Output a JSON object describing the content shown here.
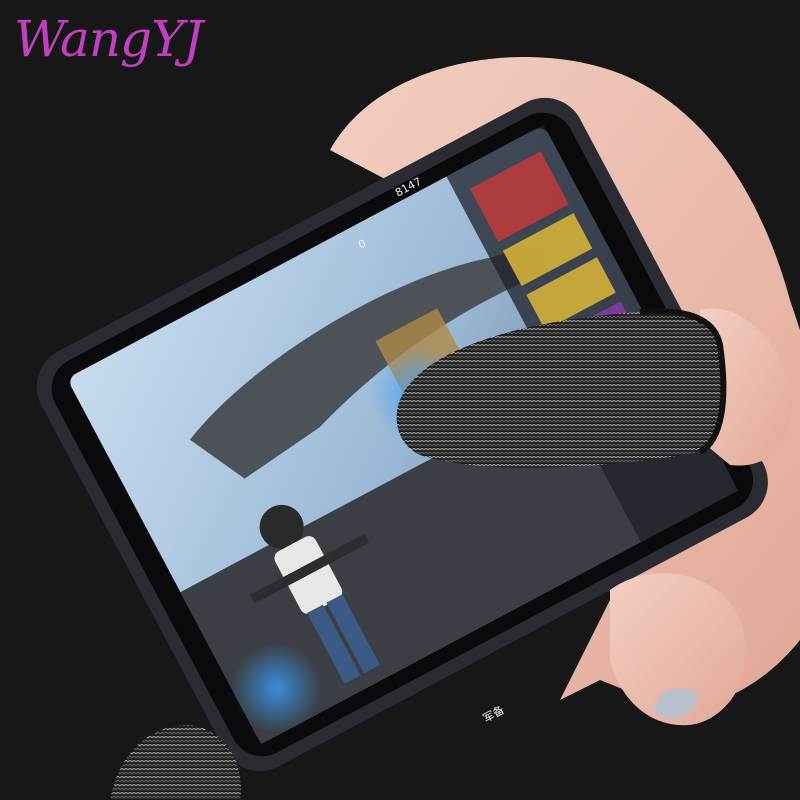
{
  "brand": {
    "logo_text": "WangYJ",
    "logo_color": "#c13fc0"
  },
  "game_hud": {
    "player_id": "8147",
    "currency_count": "0",
    "bottom_button_label": "军备"
  },
  "product": {
    "item": "gaming finger sleeve",
    "pattern": "black-white knit"
  }
}
